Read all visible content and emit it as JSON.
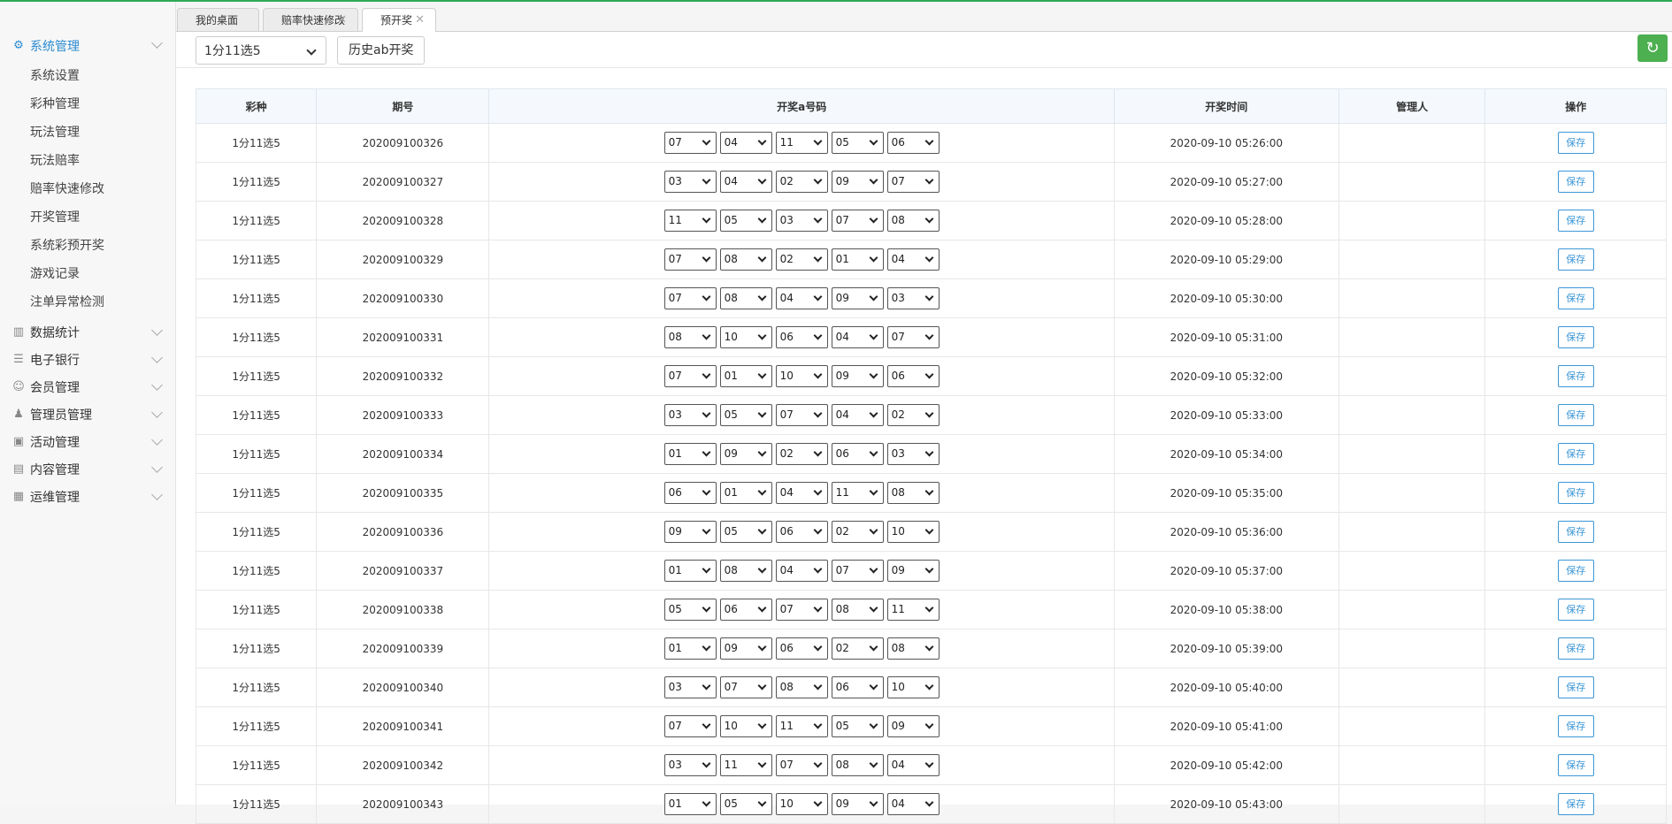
{
  "sidebar": {
    "active_group": {
      "label": "系统管理",
      "icon": "gear-icon"
    },
    "sub_items": [
      "系统设置",
      "彩种管理",
      "玩法管理",
      "玩法赔率",
      "赔率快速修改",
      "开奖管理",
      "系统彩预开奖",
      "游戏记录",
      "注单异常检测"
    ],
    "groups": [
      {
        "label": "数据统计",
        "icon": "chart-icon"
      },
      {
        "label": "电子银行",
        "icon": "list-icon"
      },
      {
        "label": "会员管理",
        "icon": "user-icon"
      },
      {
        "label": "管理员管理",
        "icon": "admin-icon"
      },
      {
        "label": "活动管理",
        "icon": "gift-icon"
      },
      {
        "label": "内容管理",
        "icon": "content-icon"
      },
      {
        "label": "运维管理",
        "icon": "ops-icon"
      }
    ]
  },
  "tabs": [
    {
      "label": "我的桌面",
      "closable": false,
      "active": false
    },
    {
      "label": "赔率快速修改",
      "closable": true,
      "active": false
    },
    {
      "label": "预开奖",
      "closable": true,
      "active": true
    }
  ],
  "toolbar": {
    "lottery_select": "1分11选5",
    "history_button": "历史ab开奖",
    "refresh_icon": "refresh-icon"
  },
  "table": {
    "headers": [
      "彩种",
      "期号",
      "开奖a号码",
      "开奖时间",
      "管理人",
      "操作"
    ],
    "save_label": "保存",
    "rows": [
      {
        "lottery": "1分11选5",
        "issue": "202009100326",
        "numbers": [
          "07",
          "04",
          "11",
          "05",
          "06"
        ],
        "time": "2020-09-10 05:26:00",
        "manager": ""
      },
      {
        "lottery": "1分11选5",
        "issue": "202009100327",
        "numbers": [
          "03",
          "04",
          "02",
          "09",
          "07"
        ],
        "time": "2020-09-10 05:27:00",
        "manager": ""
      },
      {
        "lottery": "1分11选5",
        "issue": "202009100328",
        "numbers": [
          "11",
          "05",
          "03",
          "07",
          "08"
        ],
        "time": "2020-09-10 05:28:00",
        "manager": ""
      },
      {
        "lottery": "1分11选5",
        "issue": "202009100329",
        "numbers": [
          "07",
          "08",
          "02",
          "01",
          "04"
        ],
        "time": "2020-09-10 05:29:00",
        "manager": ""
      },
      {
        "lottery": "1分11选5",
        "issue": "202009100330",
        "numbers": [
          "07",
          "08",
          "04",
          "09",
          "03"
        ],
        "time": "2020-09-10 05:30:00",
        "manager": ""
      },
      {
        "lottery": "1分11选5",
        "issue": "202009100331",
        "numbers": [
          "08",
          "10",
          "06",
          "04",
          "07"
        ],
        "time": "2020-09-10 05:31:00",
        "manager": ""
      },
      {
        "lottery": "1分11选5",
        "issue": "202009100332",
        "numbers": [
          "07",
          "01",
          "10",
          "09",
          "06"
        ],
        "time": "2020-09-10 05:32:00",
        "manager": ""
      },
      {
        "lottery": "1分11选5",
        "issue": "202009100333",
        "numbers": [
          "03",
          "05",
          "07",
          "04",
          "02"
        ],
        "time": "2020-09-10 05:33:00",
        "manager": ""
      },
      {
        "lottery": "1分11选5",
        "issue": "202009100334",
        "numbers": [
          "01",
          "09",
          "02",
          "06",
          "03"
        ],
        "time": "2020-09-10 05:34:00",
        "manager": ""
      },
      {
        "lottery": "1分11选5",
        "issue": "202009100335",
        "numbers": [
          "06",
          "01",
          "04",
          "11",
          "08"
        ],
        "time": "2020-09-10 05:35:00",
        "manager": ""
      },
      {
        "lottery": "1分11选5",
        "issue": "202009100336",
        "numbers": [
          "09",
          "05",
          "06",
          "02",
          "10"
        ],
        "time": "2020-09-10 05:36:00",
        "manager": ""
      },
      {
        "lottery": "1分11选5",
        "issue": "202009100337",
        "numbers": [
          "01",
          "08",
          "04",
          "07",
          "09"
        ],
        "time": "2020-09-10 05:37:00",
        "manager": ""
      },
      {
        "lottery": "1分11选5",
        "issue": "202009100338",
        "numbers": [
          "05",
          "06",
          "07",
          "08",
          "11"
        ],
        "time": "2020-09-10 05:38:00",
        "manager": ""
      },
      {
        "lottery": "1分11选5",
        "issue": "202009100339",
        "numbers": [
          "01",
          "09",
          "06",
          "02",
          "08"
        ],
        "time": "2020-09-10 05:39:00",
        "manager": ""
      },
      {
        "lottery": "1分11选5",
        "issue": "202009100340",
        "numbers": [
          "03",
          "07",
          "08",
          "06",
          "10"
        ],
        "time": "2020-09-10 05:40:00",
        "manager": ""
      },
      {
        "lottery": "1分11选5",
        "issue": "202009100341",
        "numbers": [
          "07",
          "10",
          "11",
          "05",
          "09"
        ],
        "time": "2020-09-10 05:41:00",
        "manager": ""
      },
      {
        "lottery": "1分11选5",
        "issue": "202009100342",
        "numbers": [
          "03",
          "11",
          "07",
          "08",
          "04"
        ],
        "time": "2020-09-10 05:42:00",
        "manager": ""
      },
      {
        "lottery": "1分11选5",
        "issue": "202009100343",
        "numbers": [
          "01",
          "05",
          "10",
          "09",
          "04"
        ],
        "time": "2020-09-10 05:43:00",
        "manager": ""
      }
    ]
  },
  "colors": {
    "accent": "#2a8bd0",
    "refresh_button": "#4caf50",
    "save_button_border": "#3b97d7",
    "top_line": "#2eaa57"
  }
}
